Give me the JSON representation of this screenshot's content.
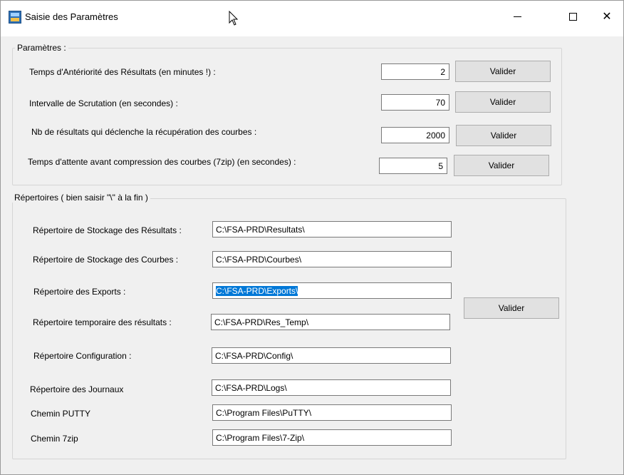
{
  "window": {
    "title": "Saisie des Paramètres",
    "min_glyph": "",
    "close_glyph": "✕"
  },
  "params": {
    "legend": "Paramètres :",
    "rows": [
      {
        "label": "Temps d'Antériorité des Résultats (en minutes !) :",
        "value": "2",
        "button": "Valider"
      },
      {
        "label": "Intervalle de Scrutation (en secondes) :",
        "value": "70",
        "button": "Valider"
      },
      {
        "label": "Nb de résultats qui déclenche la récupération des courbes :",
        "value": "2000",
        "button": "Valider"
      },
      {
        "label": "Temps d'attente avant compression des courbes (7zip) (en secondes) :",
        "value": "5",
        "button": "Valider"
      }
    ]
  },
  "dirs": {
    "legend": "Répertoires ( bien saisir \"\\\" à la fin )",
    "rows": [
      {
        "label": "Répertoire de Stockage des Résultats :",
        "value": "C:\\FSA-PRD\\Resultats\\"
      },
      {
        "label": "Répertoire de Stockage des Courbes :",
        "value": "C:\\FSA-PRD\\Courbes\\"
      },
      {
        "label": "Répertoire des Exports :",
        "value": "C:\\FSA-PRD\\Exports\\"
      },
      {
        "label": "Répertoire temporaire des résultats :",
        "value": "C:\\FSA-PRD\\Res_Temp\\"
      },
      {
        "label": "Répertoire Configuration :",
        "value": "C:\\FSA-PRD\\Config\\"
      },
      {
        "label": "Répertoire des Journaux",
        "value": "C:\\FSA-PRD\\Logs\\"
      },
      {
        "label": "Chemin PUTTY",
        "value": "C:\\Program Files\\PuTTY\\"
      },
      {
        "label": "Chemin 7zip",
        "value": "C:\\Program Files\\7-Zip\\"
      }
    ],
    "button": "Valider"
  }
}
